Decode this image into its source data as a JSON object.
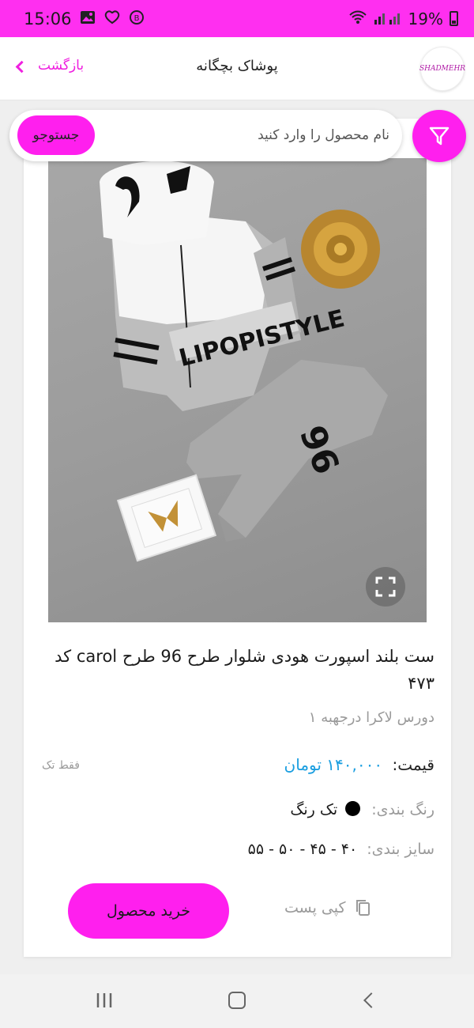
{
  "status_bar": {
    "time": "15:06",
    "battery": "19%"
  },
  "header": {
    "back_label": "بازگشت",
    "title": "پوشاک بچگانه",
    "logo_text": "SHADMEHR"
  },
  "search": {
    "placeholder": "نام محصول را وارد کنید",
    "button_label": "جستوجو"
  },
  "product": {
    "image_print_text": "LIPOPISTYLE",
    "image_number": "96",
    "title": "ست بلند اسپورت هودی شلوار طرح 96 طرح carol کد ۴۷۳",
    "subtitle": "دورس لاکرا درجهبه ۱",
    "price_label": "قیمت:",
    "price_value": "۱۴۰,۰۰۰ تومان",
    "stock_note": "فقط تک",
    "color_label": "رنگ بندی:",
    "color_value": "تک رنگ",
    "color_swatch": "#000000",
    "size_label": "سایز بندی:",
    "size_value": "۴۰ - ۴۵ - ۵۰ - ۵۵"
  },
  "actions": {
    "buy_label": "خرید محصول",
    "copy_label": "کپی پست"
  },
  "colors": {
    "accent": "#ff1fee",
    "price": "#1a9ee0"
  }
}
